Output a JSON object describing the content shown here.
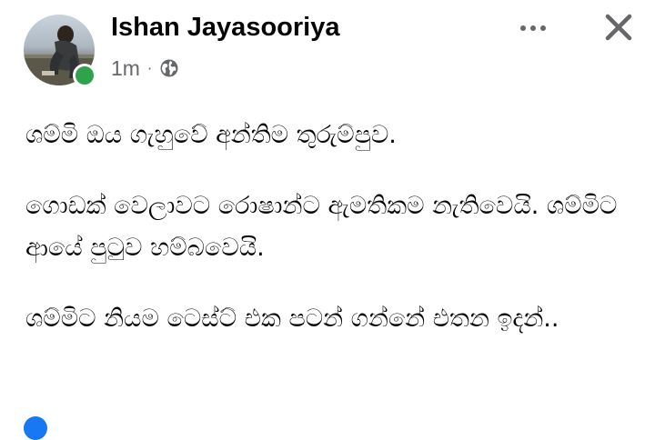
{
  "post": {
    "author": {
      "name": "Ishan Jayasooriya",
      "avatar_icon": "profile-photo",
      "online": true
    },
    "meta": {
      "time": "1m",
      "separator": "·",
      "audience_icon": "globe-icon"
    },
    "actions": {
      "more_icon": "more-horizontal-icon",
      "close_icon": "close-icon"
    },
    "body": {
      "paragraphs": [
        "ශම්මි ඔය ගැහුවේ අන්තිම තුරුම්පුව.",
        "ගොඩක් වෙලාවට රොෂාන්ට ඇමතිකම නැතිවෙයි. ශම්මිට ආයේ පුටුව හම්බවෙයි.",
        "ශම්මිට නියම ටෙස්ට් එක පටන් ගන්නේ එතන ඉදන්.."
      ]
    }
  },
  "colors": {
    "online": "#31a24c",
    "secondary_text": "#65676b",
    "primary_text": "#050505",
    "reaction_blue": "#1877f2"
  }
}
